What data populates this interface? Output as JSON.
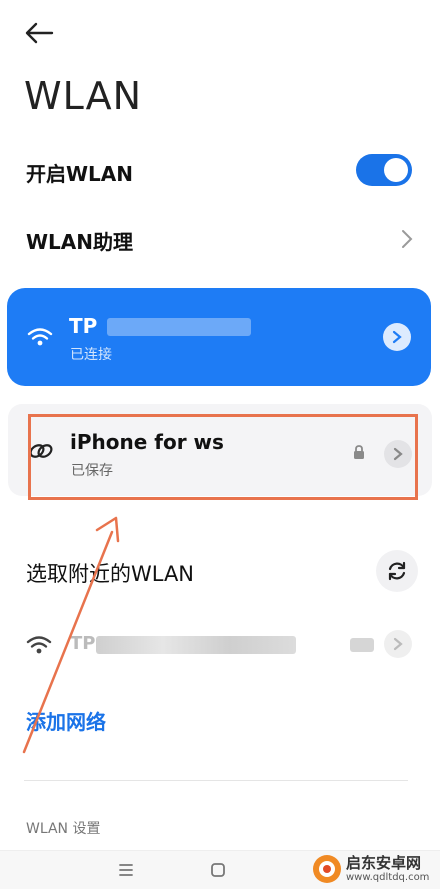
{
  "header": {
    "title": "WLAN"
  },
  "wlan_toggle": {
    "label": "开启WLAN",
    "on": true
  },
  "assistant": {
    "label": "WLAN助理"
  },
  "connected_network": {
    "name": "TP",
    "status": "已连接"
  },
  "saved_network": {
    "name": "iPhone for ws",
    "status": "已保存"
  },
  "nearby": {
    "title": "选取附近的WLAN",
    "items": [
      {
        "name": "TP"
      }
    ]
  },
  "add_network": {
    "label": "添加网络"
  },
  "settings": {
    "title": "WLAN 设置"
  },
  "watermark": {
    "brand": "启东安卓网",
    "url": "www.qdltdq.com"
  },
  "colors": {
    "accent": "#1e7cf5",
    "highlight": "#e8734d"
  }
}
